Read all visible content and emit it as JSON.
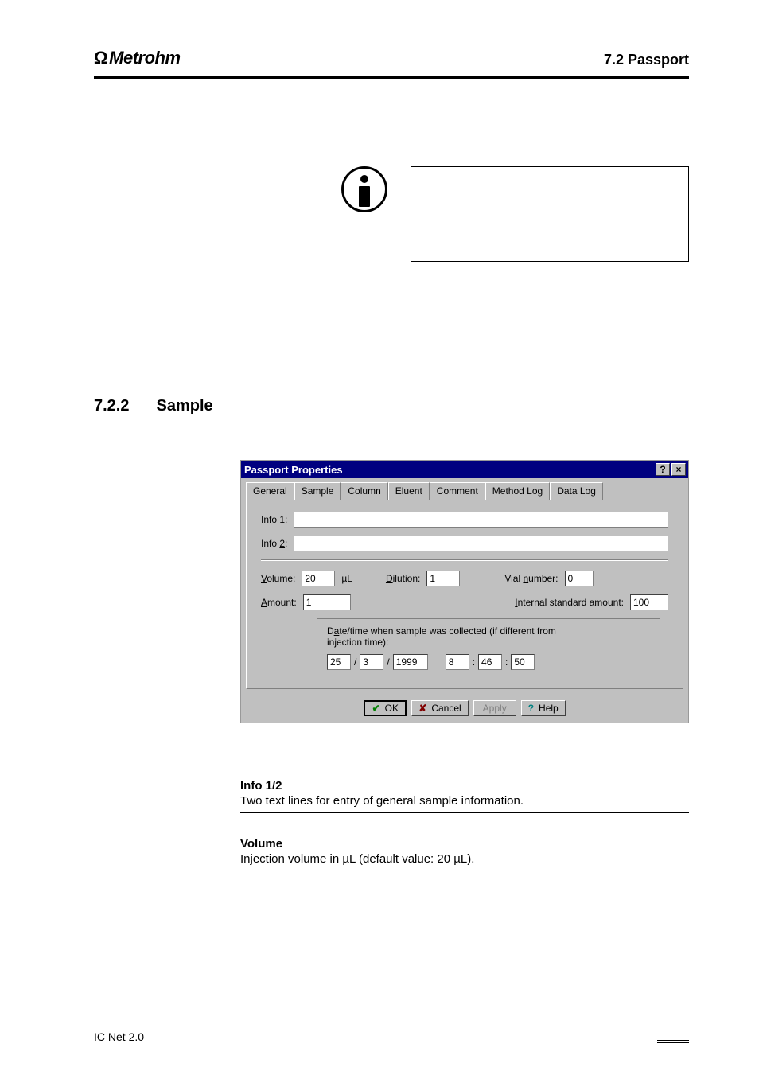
{
  "header": {
    "brand": "Metrohm",
    "section": "7.2  Passport"
  },
  "section_heading": {
    "num": "7.2.2",
    "title": "Sample"
  },
  "dialog": {
    "title": "Passport Properties",
    "title_btn_help": "?",
    "title_btn_close": "×",
    "tabs": {
      "general": "General",
      "sample": "Sample",
      "column": "Column",
      "eluent": "Eluent",
      "comment": "Comment",
      "method_log": "Method Log",
      "data_log": "Data Log"
    },
    "labels": {
      "info1_pre": "Info ",
      "info1_u": "1",
      "info1_post": ":",
      "info2_pre": "Info ",
      "info2_u": "2",
      "info2_post": ":",
      "volume_u": "V",
      "volume_rest": "olume:",
      "vol_unit": "µL",
      "dilution_u": "D",
      "dilution_rest": "ilution:",
      "vial_pre": "Vial ",
      "vial_u": "n",
      "vial_post": "umber:",
      "amount_u": "A",
      "amount_rest": "mount:",
      "istd_u": "I",
      "istd_rest": "nternal standard amount:",
      "dt_pre": "D",
      "dt_u": "a",
      "dt_post": "te/time when sample was collected (if different from injection time):"
    },
    "values": {
      "info1": "",
      "info2": "",
      "volume": "20",
      "dilution": "1",
      "vial": "0",
      "amount": "1",
      "istd": "100",
      "d": "25",
      "m": "3",
      "y": "1999",
      "hh": "8",
      "mm": "46",
      "ss": "50"
    },
    "sep_slash": "/",
    "sep_colon": ":",
    "buttons": {
      "ok": "OK",
      "cancel": "Cancel",
      "apply": "Apply",
      "help": "Help"
    }
  },
  "descr": {
    "info1_label": "Info 1/2",
    "info1_text": "Two text lines for entry of general sample information.",
    "vol_label": "Volume",
    "vol_text": "Injection volume in µL (default value: 20 µL)."
  },
  "footer": {
    "left": "IC Net 2.0",
    "page": ""
  }
}
